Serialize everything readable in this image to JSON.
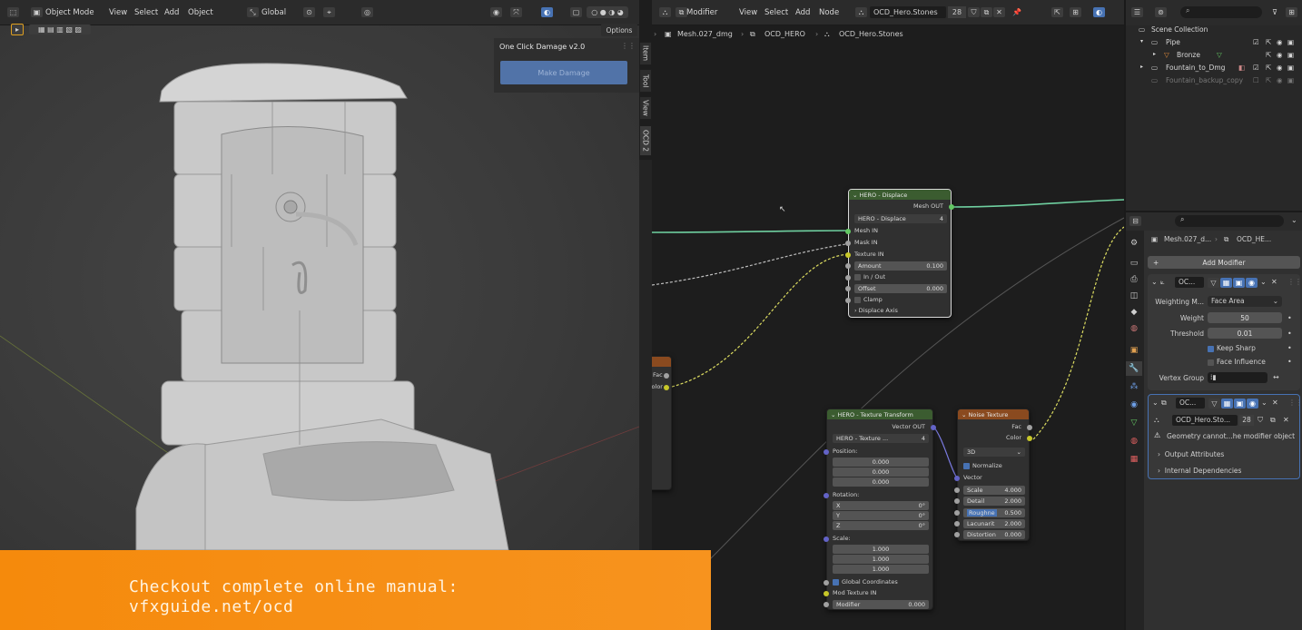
{
  "viewport": {
    "header": {
      "mode_label": "Object Mode",
      "menu": [
        "View",
        "Select",
        "Add",
        "Object"
      ],
      "orientation_label": "Global"
    },
    "n_panel": {
      "section_title": "One Click Damage v2.0",
      "make_damage_button": "Make Damage",
      "options_label": "Options",
      "tabs": [
        "Item",
        "Tool",
        "View",
        "OCD 2"
      ]
    }
  },
  "node_editor": {
    "header": {
      "type_label": "Modifier",
      "menu": [
        "View",
        "Select",
        "Add",
        "Node"
      ],
      "nodegroup_name": "OCD_Hero.Stones",
      "user_count": "28"
    },
    "breadcrumb": [
      "Mesh.027_dmg",
      "OCD_HERO",
      "OCD_Hero.Stones"
    ],
    "displace_node": {
      "title": "HERO - Displace",
      "output": "Mesh OUT",
      "group": "HERO - Displace",
      "group_count": "4",
      "inputs": [
        "Mesh IN",
        "Mask IN",
        "Texture IN"
      ],
      "amount_label": "Amount",
      "amount_value": "0.100",
      "inout_label": "In / Out",
      "offset_label": "Offset",
      "offset_value": "0.000",
      "clamp_label": "Clamp",
      "axis_label": "Displace Axis"
    },
    "transform_node": {
      "title": "HERO - Texture Transform",
      "output": "Vector OUT",
      "group": "HERO - Texture ...",
      "group_count": "4",
      "position_label": "Position:",
      "position": [
        "0.000",
        "0.000",
        "0.000"
      ],
      "rotation_label": "Rotation:",
      "rotation": [
        {
          "axis": "X",
          "value": "0°"
        },
        {
          "axis": "Y",
          "value": "0°"
        },
        {
          "axis": "Z",
          "value": "0°"
        }
      ],
      "scale_label": "Scale:",
      "scale": [
        "1.000",
        "1.000",
        "1.000"
      ],
      "global_coords": "Global Coordinates",
      "mod_texture": "Mod Texture IN",
      "modifier_label": "Modifier",
      "modifier_value": "0.000"
    },
    "noise_node": {
      "title": "Noise Texture",
      "outputs": [
        "Fac",
        "Color"
      ],
      "dim": "3D",
      "normalize": "Normalize",
      "vector": "Vector",
      "params": [
        {
          "label": "Scale",
          "value": "4.000"
        },
        {
          "label": "Detail",
          "value": "2.000"
        },
        {
          "label": "Roughne",
          "value": "0.500"
        },
        {
          "label": "Lacunarit",
          "value": "2.000"
        },
        {
          "label": "Distortion",
          "value": "0.000"
        }
      ]
    },
    "partial_node": {
      "outputs": [
        "Fac",
        "Color"
      ]
    }
  },
  "outliner": {
    "items": [
      {
        "label": "Scene Collection"
      },
      {
        "label": "Pipe"
      },
      {
        "label": "Bronze"
      },
      {
        "label": "Fountain_to_Dmg"
      },
      {
        "label": "Fountain_backup_copy"
      }
    ]
  },
  "properties": {
    "breadcrumb": [
      "Mesh.027_d...",
      "OCD_HE..."
    ],
    "add_modifier": "Add Modifier",
    "mod1": {
      "name": "OC...",
      "weighting_label": "Weighting M...",
      "weighting_value": "Face Area",
      "weight_label": "Weight",
      "weight_value": "50",
      "threshold_label": "Threshold",
      "threshold_value": "0.01",
      "keep_sharp": "Keep Sharp",
      "face_influence": "Face Influence",
      "vertex_group_label": "Vertex Group"
    },
    "mod2": {
      "name": "OC...",
      "nodegroup": "OCD_Hero.Sto...",
      "count": "28",
      "warning": "Geometry cannot...he modifier object",
      "output_attrs": "Output Attributes",
      "internal_deps": "Internal Dependencies"
    }
  },
  "banner": {
    "line1": "Checkout complete online manual:",
    "line2": "vfxguide.net/ocd"
  },
  "colors": {
    "accent": "#4772b3",
    "banner": "#f58a0c",
    "displace_header": "#3b5c30",
    "transform_header": "#3b5c30",
    "noise_header": "#8a4a1f"
  }
}
